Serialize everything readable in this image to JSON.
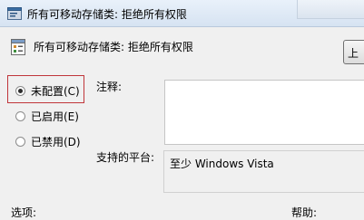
{
  "window": {
    "title": "所有可移动存储类: 拒绝所有权限",
    "title_icon": "policy-window-icon"
  },
  "header": {
    "policy_name": "所有可移动存储类: 拒绝所有权限",
    "policy_icon": "policy-settings-icon",
    "right_button_label": "上"
  },
  "state": {
    "options": [
      {
        "label": "未配置(C)",
        "checked": true
      },
      {
        "label": "已启用(E)",
        "checked": false
      },
      {
        "label": "已禁用(D)",
        "checked": false
      }
    ]
  },
  "fields": {
    "comment_label": "注释:",
    "comment_value": "",
    "platform_label": "支持的平台:",
    "platform_value": "至少 Windows Vista"
  },
  "footer": {
    "options_label": "选项:",
    "help_label": "帮助:"
  },
  "colors": {
    "focus_border": "#c0353a",
    "titlebar": "#dde8f5"
  }
}
